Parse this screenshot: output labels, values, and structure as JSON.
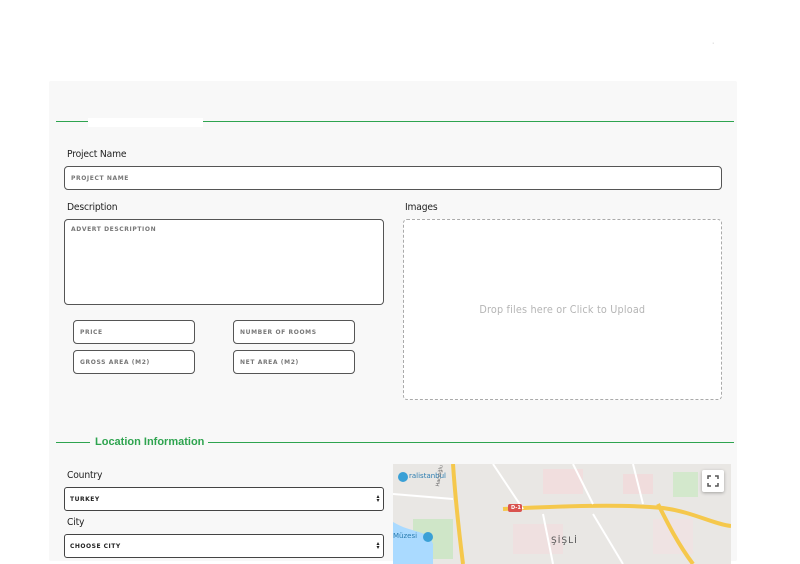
{
  "corner_mark": "·",
  "project": {
    "name_label": "Project Name",
    "name_placeholder": "PROJECT NAME",
    "description_label": "Description",
    "description_placeholder": "ADVERT DESCRIPTION",
    "images_label": "Images",
    "dropzone_text": "Drop files here or Click to Upload",
    "price_placeholder": "PRICE",
    "rooms_placeholder": "NUMBER OF ROOMS",
    "gross_area_placeholder": "GROSS AREA (M2)",
    "net_area_placeholder": "NET AREA (M2)"
  },
  "location": {
    "section_title": "Location Information",
    "country_label": "Country",
    "country_value": "TURKEY",
    "city_label": "City",
    "city_value": "CHOOSE CITY"
  },
  "map": {
    "labels": {
      "district": "ŞİŞLİ",
      "museum": "Müzesi",
      "poi": "ralistanbul",
      "road": "D-1",
      "street": "Hacıoğlu Ömerefendi Bağlantı"
    },
    "fullscreen_icon": "fullscreen-icon"
  },
  "colors": {
    "accent": "#2ea44f",
    "panel_bg": "#f8f8f8"
  }
}
